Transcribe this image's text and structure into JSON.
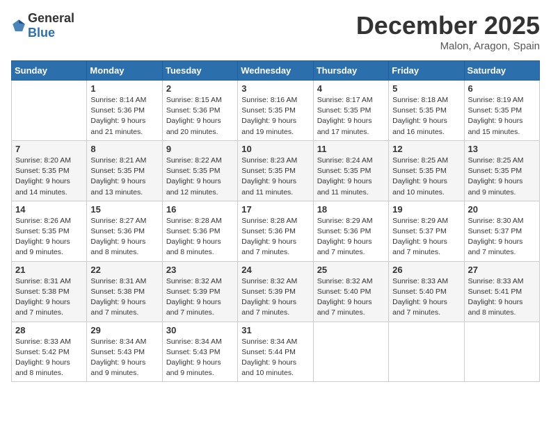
{
  "header": {
    "logo_general": "General",
    "logo_blue": "Blue",
    "month": "December 2025",
    "location": "Malon, Aragon, Spain"
  },
  "weekdays": [
    "Sunday",
    "Monday",
    "Tuesday",
    "Wednesday",
    "Thursday",
    "Friday",
    "Saturday"
  ],
  "weeks": [
    [
      {
        "day": "",
        "info": ""
      },
      {
        "day": "1",
        "info": "Sunrise: 8:14 AM\nSunset: 5:36 PM\nDaylight: 9 hours\nand 21 minutes."
      },
      {
        "day": "2",
        "info": "Sunrise: 8:15 AM\nSunset: 5:36 PM\nDaylight: 9 hours\nand 20 minutes."
      },
      {
        "day": "3",
        "info": "Sunrise: 8:16 AM\nSunset: 5:35 PM\nDaylight: 9 hours\nand 19 minutes."
      },
      {
        "day": "4",
        "info": "Sunrise: 8:17 AM\nSunset: 5:35 PM\nDaylight: 9 hours\nand 17 minutes."
      },
      {
        "day": "5",
        "info": "Sunrise: 8:18 AM\nSunset: 5:35 PM\nDaylight: 9 hours\nand 16 minutes."
      },
      {
        "day": "6",
        "info": "Sunrise: 8:19 AM\nSunset: 5:35 PM\nDaylight: 9 hours\nand 15 minutes."
      }
    ],
    [
      {
        "day": "7",
        "info": "Sunrise: 8:20 AM\nSunset: 5:35 PM\nDaylight: 9 hours\nand 14 minutes."
      },
      {
        "day": "8",
        "info": "Sunrise: 8:21 AM\nSunset: 5:35 PM\nDaylight: 9 hours\nand 13 minutes."
      },
      {
        "day": "9",
        "info": "Sunrise: 8:22 AM\nSunset: 5:35 PM\nDaylight: 9 hours\nand 12 minutes."
      },
      {
        "day": "10",
        "info": "Sunrise: 8:23 AM\nSunset: 5:35 PM\nDaylight: 9 hours\nand 11 minutes."
      },
      {
        "day": "11",
        "info": "Sunrise: 8:24 AM\nSunset: 5:35 PM\nDaylight: 9 hours\nand 11 minutes."
      },
      {
        "day": "12",
        "info": "Sunrise: 8:25 AM\nSunset: 5:35 PM\nDaylight: 9 hours\nand 10 minutes."
      },
      {
        "day": "13",
        "info": "Sunrise: 8:25 AM\nSunset: 5:35 PM\nDaylight: 9 hours\nand 9 minutes."
      }
    ],
    [
      {
        "day": "14",
        "info": "Sunrise: 8:26 AM\nSunset: 5:35 PM\nDaylight: 9 hours\nand 9 minutes."
      },
      {
        "day": "15",
        "info": "Sunrise: 8:27 AM\nSunset: 5:36 PM\nDaylight: 9 hours\nand 8 minutes."
      },
      {
        "day": "16",
        "info": "Sunrise: 8:28 AM\nSunset: 5:36 PM\nDaylight: 9 hours\nand 8 minutes."
      },
      {
        "day": "17",
        "info": "Sunrise: 8:28 AM\nSunset: 5:36 PM\nDaylight: 9 hours\nand 7 minutes."
      },
      {
        "day": "18",
        "info": "Sunrise: 8:29 AM\nSunset: 5:36 PM\nDaylight: 9 hours\nand 7 minutes."
      },
      {
        "day": "19",
        "info": "Sunrise: 8:29 AM\nSunset: 5:37 PM\nDaylight: 9 hours\nand 7 minutes."
      },
      {
        "day": "20",
        "info": "Sunrise: 8:30 AM\nSunset: 5:37 PM\nDaylight: 9 hours\nand 7 minutes."
      }
    ],
    [
      {
        "day": "21",
        "info": "Sunrise: 8:31 AM\nSunset: 5:38 PM\nDaylight: 9 hours\nand 7 minutes."
      },
      {
        "day": "22",
        "info": "Sunrise: 8:31 AM\nSunset: 5:38 PM\nDaylight: 9 hours\nand 7 minutes."
      },
      {
        "day": "23",
        "info": "Sunrise: 8:32 AM\nSunset: 5:39 PM\nDaylight: 9 hours\nand 7 minutes."
      },
      {
        "day": "24",
        "info": "Sunrise: 8:32 AM\nSunset: 5:39 PM\nDaylight: 9 hours\nand 7 minutes."
      },
      {
        "day": "25",
        "info": "Sunrise: 8:32 AM\nSunset: 5:40 PM\nDaylight: 9 hours\nand 7 minutes."
      },
      {
        "day": "26",
        "info": "Sunrise: 8:33 AM\nSunset: 5:40 PM\nDaylight: 9 hours\nand 7 minutes."
      },
      {
        "day": "27",
        "info": "Sunrise: 8:33 AM\nSunset: 5:41 PM\nDaylight: 9 hours\nand 8 minutes."
      }
    ],
    [
      {
        "day": "28",
        "info": "Sunrise: 8:33 AM\nSunset: 5:42 PM\nDaylight: 9 hours\nand 8 minutes."
      },
      {
        "day": "29",
        "info": "Sunrise: 8:34 AM\nSunset: 5:43 PM\nDaylight: 9 hours\nand 9 minutes."
      },
      {
        "day": "30",
        "info": "Sunrise: 8:34 AM\nSunset: 5:43 PM\nDaylight: 9 hours\nand 9 minutes."
      },
      {
        "day": "31",
        "info": "Sunrise: 8:34 AM\nSunset: 5:44 PM\nDaylight: 9 hours\nand 10 minutes."
      },
      {
        "day": "",
        "info": ""
      },
      {
        "day": "",
        "info": ""
      },
      {
        "day": "",
        "info": ""
      }
    ]
  ]
}
